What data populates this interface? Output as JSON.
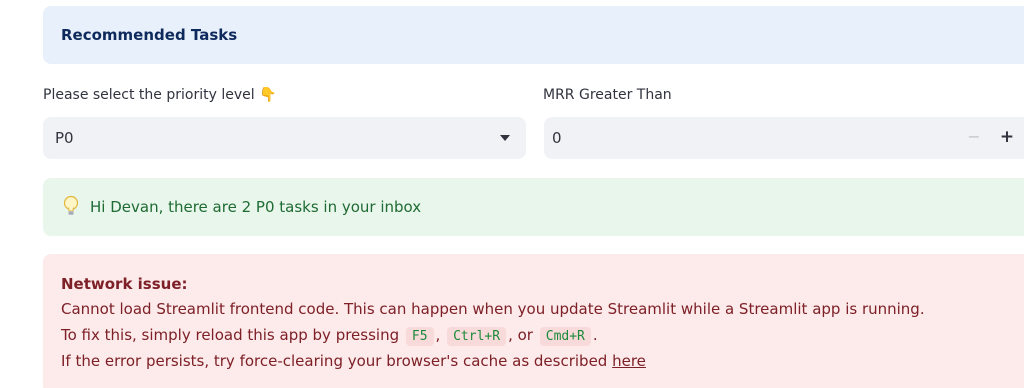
{
  "header": {
    "title": "Recommended Tasks"
  },
  "priority_select": {
    "label": "Please select the priority level 👇",
    "value": "P0"
  },
  "mrr_input": {
    "label": "MRR Greater Than",
    "value": "0",
    "minus_symbol": "−",
    "plus_symbol": "+"
  },
  "info_alert": {
    "icon": "lightbulb-icon",
    "message": "Hi Devan, there are 2 P0 tasks in your inbox"
  },
  "error_alert": {
    "title": "Network issue:",
    "line1": "Cannot load Streamlit frontend code. This can happen when you update Streamlit while a Streamlit app is running.",
    "line2_prefix": "To fix this, simply reload this app by pressing",
    "key_f5": "F5",
    "sep_comma": ",",
    "key_ctrl_r": "Ctrl+R",
    "sep_or": ", or",
    "key_cmd_r": "Cmd+R",
    "line2_suffix": ".",
    "line3_prefix": "If the error persists, try force-clearing your browser's cache as described",
    "link_text": "here"
  },
  "colors": {
    "header_bg": "#e8f0fb",
    "info_bg": "#e9f6ec",
    "info_text": "#1e6b33",
    "error_bg": "#fdeaea",
    "error_text": "#7d2027",
    "code_text": "#1b8a3a"
  }
}
